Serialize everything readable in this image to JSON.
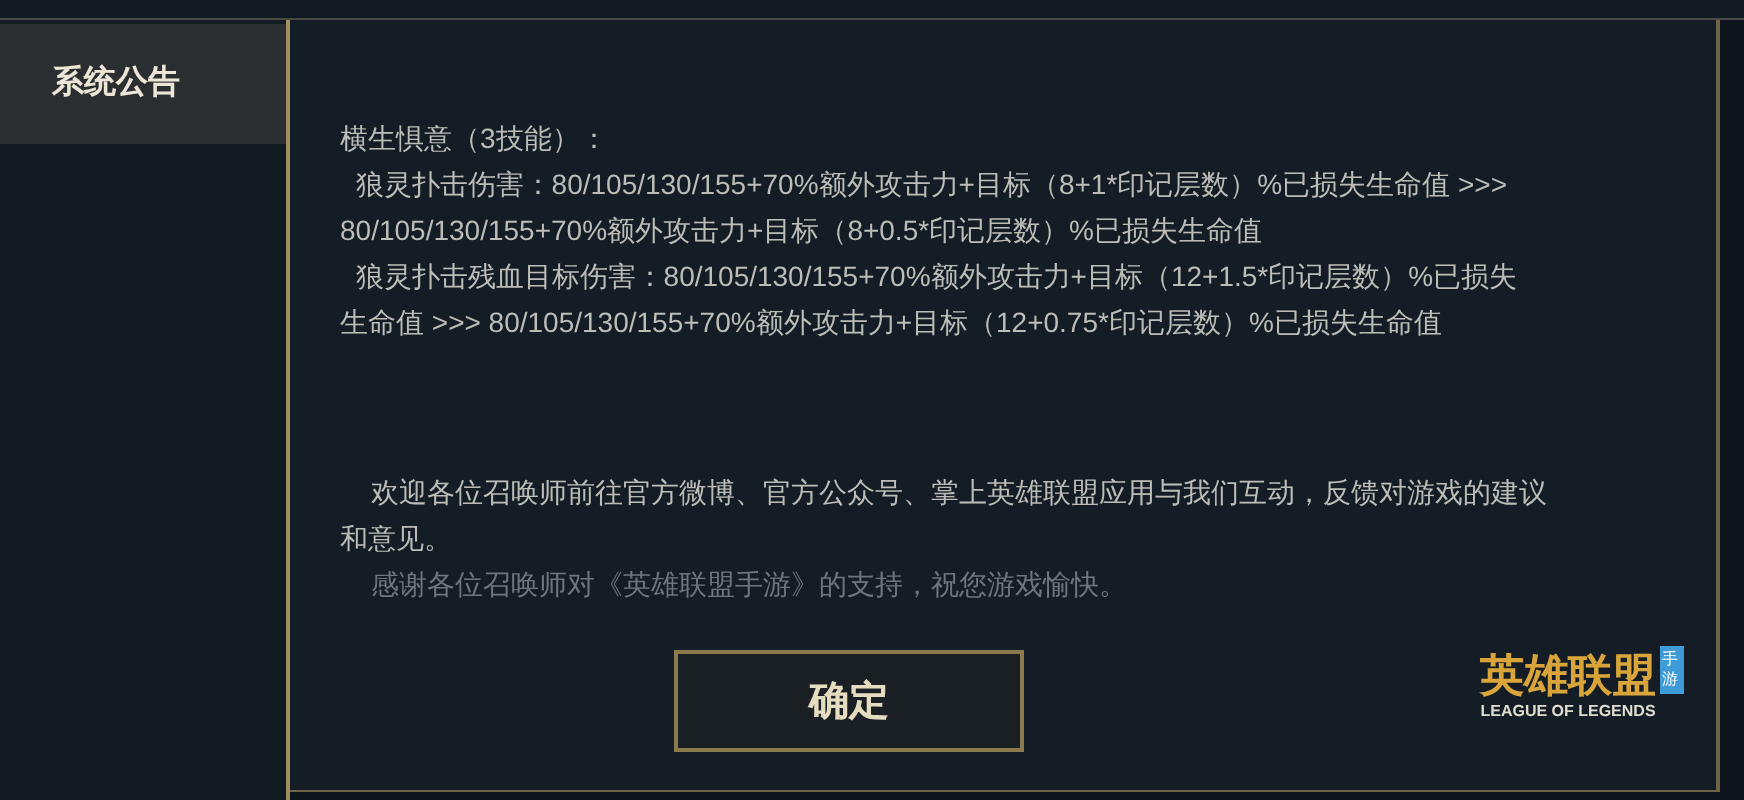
{
  "sidebar": {
    "tabs": [
      {
        "label": "系统公告",
        "selected": true
      }
    ]
  },
  "notice": {
    "blocks": [
      {
        "faded": false,
        "lines": [
          "横生惧意（3技能）：",
          "  狼灵扑击伤害：80/105/130/155+70%额外攻击力+目标（8+1*印记层数）%已损失生命值 >>>",
          "80/105/130/155+70%额外攻击力+目标（8+0.5*印记层数）%已损失生命值",
          "  狼灵扑击残血目标伤害：80/105/130/155+70%额外攻击力+目标（12+1.5*印记层数）%已损失",
          "生命值 >>> 80/105/130/155+70%额外攻击力+目标（12+0.75*印记层数）%已损失生命值"
        ]
      },
      {
        "faded": false,
        "lines": [
          "    欢迎各位召唤师前往官方微博、官方公众号、掌上英雄联盟应用与我们互动，反馈对游戏的建议",
          "和意见。"
        ]
      },
      {
        "faded": true,
        "lines": [
          "    感谢各位召唤师对《英雄联盟手游》的支持，祝您游戏愉快。"
        ]
      }
    ]
  },
  "confirm_button": "确定",
  "logo": {
    "title": "英雄联盟",
    "badge": "手游",
    "subtitle": "LEAGUE OF LEGENDS"
  }
}
